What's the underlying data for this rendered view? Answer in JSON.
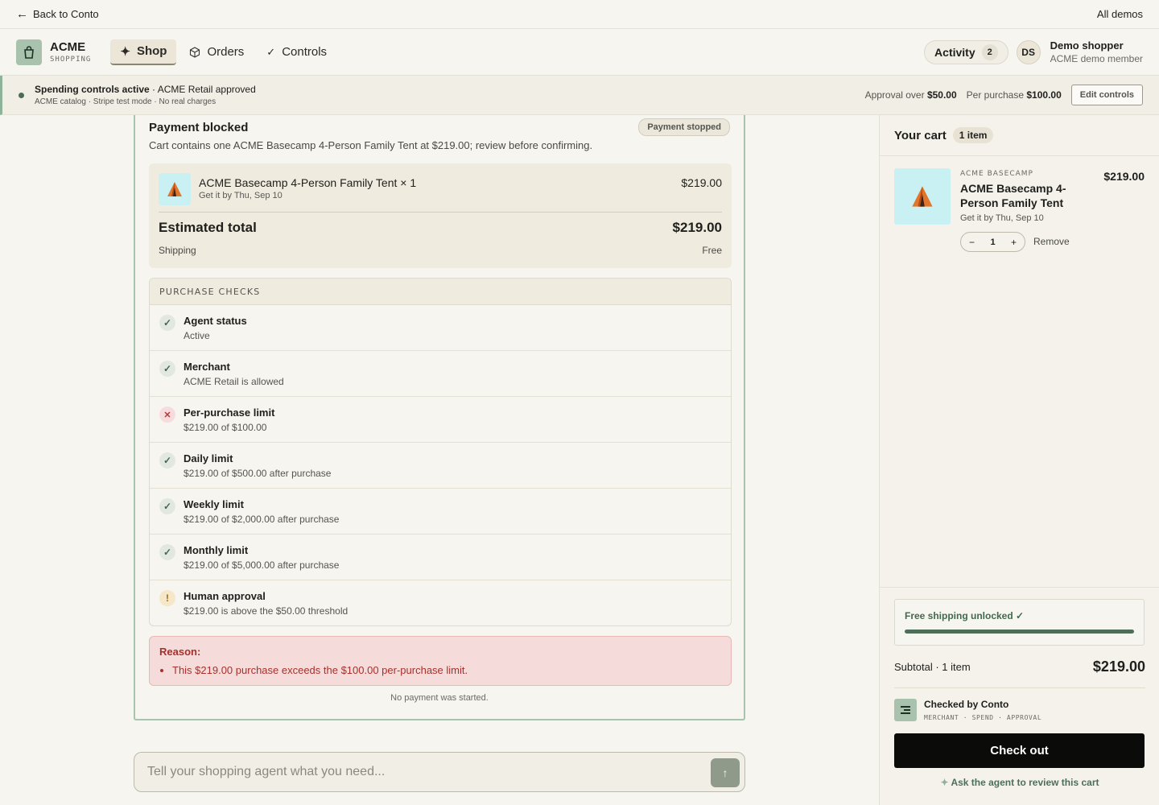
{
  "topbar": {
    "back_label": "Back to Conto",
    "demos_label": "All demos"
  },
  "nav": {
    "brand_name": "ACME",
    "brand_sub": "SHOPPING",
    "tabs": [
      {
        "label": "Shop",
        "icon": "sparkle-icon",
        "active": true
      },
      {
        "label": "Orders",
        "icon": "box-icon",
        "active": false
      },
      {
        "label": "Controls",
        "icon": "check-icon",
        "active": false
      }
    ],
    "activity_label": "Activity",
    "activity_count": "2",
    "avatar_initials": "DS",
    "user_name": "Demo shopper",
    "user_role": "ACME demo member"
  },
  "banner": {
    "status_bold": "Spending controls active",
    "status_rest": " · ACME Retail approved",
    "subtext": "ACME catalog · Stripe test mode · No real charges",
    "approval_label": "Approval over",
    "approval_value": "$50.00",
    "per_purchase_label": "Per purchase",
    "per_purchase_value": "$100.00",
    "edit_label": "Edit controls"
  },
  "payment": {
    "title": "Payment blocked",
    "badge": "Payment stopped",
    "description": "Cart contains one ACME Basecamp 4-Person Family Tent at $219.00; review before confirming.",
    "item_name": "ACME Basecamp 4-Person Family Tent × 1",
    "item_delivery": "Get it by Thu, Sep 10",
    "item_price": "$219.00",
    "total_label": "Estimated total",
    "total_value": "$219.00",
    "shipping_label": "Shipping",
    "shipping_value": "Free",
    "checks_header": "PURCHASE CHECKS",
    "checks": [
      {
        "title": "Agent status",
        "detail": "Active",
        "status": "pass"
      },
      {
        "title": "Merchant",
        "detail": "ACME Retail is allowed",
        "status": "pass"
      },
      {
        "title": "Per-purchase limit",
        "detail": "$219.00 of $100.00",
        "status": "fail"
      },
      {
        "title": "Daily limit",
        "detail": "$219.00 of $500.00 after purchase",
        "status": "pass"
      },
      {
        "title": "Weekly limit",
        "detail": "$219.00 of $2,000.00 after purchase",
        "status": "pass"
      },
      {
        "title": "Monthly limit",
        "detail": "$219.00 of $5,000.00 after purchase",
        "status": "pass"
      },
      {
        "title": "Human approval",
        "detail": "$219.00 is above the $50.00 threshold",
        "status": "warn"
      }
    ],
    "reason_label": "Reason:",
    "reason_item": "This $219.00 purchase exceeds the $100.00 per-purchase limit.",
    "footnote": "No payment was started."
  },
  "prompt": {
    "placeholder": "Tell your shopping agent what you need..."
  },
  "cart": {
    "title": "Your cart",
    "count_label": "1 item",
    "item": {
      "brand": "ACME BASECAMP",
      "name": "ACME Basecamp 4-Person Family Tent",
      "price": "$219.00",
      "delivery": "Get it by Thu, Sep 10",
      "quantity": "1",
      "remove_label": "Remove"
    },
    "free_shipping_label": "Free shipping unlocked ✓",
    "free_shipping_progress": 1.0,
    "subtotal_label": "Subtotal · 1 item",
    "subtotal_value": "$219.00",
    "checked_title": "Checked by Conto",
    "checked_sub": "MERCHANT · SPEND · APPROVAL",
    "checkout_label": "Check out",
    "ask_label": "Ask the agent to review this cart"
  },
  "colors": {
    "accent_green": "#4f6e5a",
    "error_red": "#a6302c",
    "checkout_black": "#0b0b0a"
  }
}
